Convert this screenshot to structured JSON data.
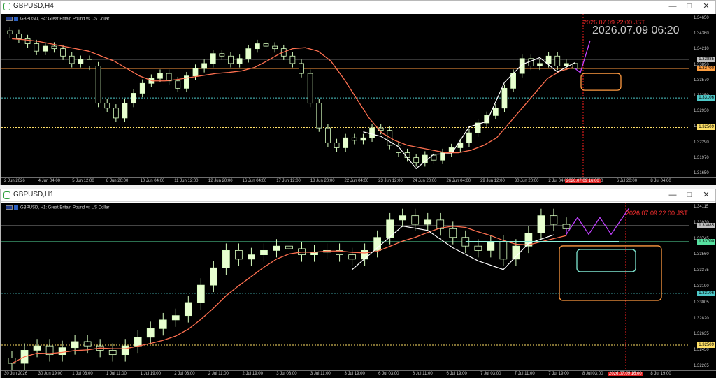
{
  "windows": [
    {
      "title": "GBPUSD,H4",
      "header": "GBPUSD, H4:  Great Britain Pound vs US Dollar",
      "overlay_date": "2026.07.09 06:20",
      "marker_label": "2026.07.09 22:00 JST",
      "cursor_date_tag": "2026.07.09 16:00",
      "price_ticks": [
        "1.34650",
        "1.34360",
        "1.34210",
        "1.33890",
        "1.33570",
        "1.33250",
        "1.32930",
        "1.32610",
        "1.32290",
        "1.31970",
        "1.31650"
      ],
      "price_tags": [
        {
          "value": "1.33885",
          "color": "#c0c0c0"
        },
        {
          "value": "1.33700",
          "color": "#ff9f40"
        },
        {
          "value": "1.33106",
          "color": "#4ec9c9"
        },
        {
          "value": "1.32509",
          "color": "#ffe066"
        }
      ],
      "time_ticks": [
        "2 Jun 2026",
        "4 Jun 04:00",
        "5 Jun 12:00",
        "8 Jun 20:00",
        "10 Jun 04:00",
        "11 Jun 12:00",
        "12 Jun 20:00",
        "16 Jun 04:00",
        "17 Jun 12:00",
        "18 Jun 20:00",
        "22 Jun 04:00",
        "23 Jun 12:00",
        "24 Jun 20:00",
        "26 Jun 04:00",
        "29 Jun 12:00",
        "30 Jun 20:00",
        "2 Jul 04:00",
        "3 Jul 12:00",
        "6 Jul 20:00",
        "8 Jul 04:00"
      ]
    },
    {
      "title": "GBPUSD,H1",
      "header": "GBPUSD, H1:  Great Britain Pound vs US Dollar",
      "marker_label": "2026.07.09 22:00 JST",
      "cursor_date_tag": "2026.07.09 16:00",
      "price_ticks": [
        "1.34115",
        "1.33930",
        "1.33745",
        "1.33560",
        "1.33375",
        "1.33190",
        "1.33005",
        "1.32820",
        "1.32635",
        "1.32450",
        "1.32265"
      ],
      "price_tags": [
        {
          "value": "1.33885",
          "color": "#c0c0c0"
        },
        {
          "value": "1.33700",
          "color": "#57e0a0"
        },
        {
          "value": "1.33106",
          "color": "#4ec9c9"
        },
        {
          "value": "1.32509",
          "color": "#ffe066"
        }
      ],
      "time_ticks": [
        "30 Jun 2026",
        "30 Jun 19:00",
        "1 Jul 03:00",
        "1 Jul 11:00",
        "1 Jul 19:00",
        "2 Jul 03:00",
        "2 Jul 11:00",
        "2 Jul 19:00",
        "3 Jul 03:00",
        "3 Jul 11:00",
        "3 Jul 19:00",
        "6 Jul 03:00",
        "6 Jul 11:00",
        "6 Jul 19:00",
        "7 Jul 03:00",
        "7 Jul 11:00",
        "7 Jul 19:00",
        "8 Jul 03:00",
        "8 Jul 11:00",
        "8 Jul 19:00"
      ]
    }
  ],
  "colors": {
    "bull": "#e8ffd0",
    "bear": "#cfffb0",
    "ma": "#ff7050",
    "zigzag": "#ffffff",
    "projection": "#c040ff",
    "marker": "#ff2020",
    "box": "#ff9a40",
    "box2": "#7fe6d0"
  },
  "chart_data": [
    {
      "type": "candlestick",
      "title": "GBPUSD, H4",
      "ylim": [
        1.315,
        1.348
      ],
      "closes": [
        1.344,
        1.343,
        1.342,
        1.3405,
        1.3415,
        1.341,
        1.3395,
        1.338,
        1.3388,
        1.3375,
        1.33,
        1.329,
        1.327,
        1.33,
        1.332,
        1.334,
        1.335,
        1.336,
        1.3345,
        1.333,
        1.3355,
        1.337,
        1.338,
        1.34,
        1.3395,
        1.338,
        1.339,
        1.341,
        1.342,
        1.3415,
        1.341,
        1.3395,
        1.338,
        1.336,
        1.33,
        1.325,
        1.322,
        1.321,
        1.323,
        1.3225,
        1.323,
        1.325,
        1.3245,
        1.3215,
        1.32,
        1.319,
        1.318,
        1.3195,
        1.3185,
        1.32,
        1.321,
        1.322,
        1.324,
        1.326,
        1.3275,
        1.329,
        1.333,
        1.336,
        1.339,
        1.3375,
        1.338,
        1.3395,
        1.3375,
        1.338,
        1.337
      ],
      "ma": [
        1.343,
        1.3428,
        1.3425,
        1.342,
        1.3415,
        1.341,
        1.3405,
        1.3395,
        1.3385,
        1.337,
        1.3355,
        1.3345,
        1.3345,
        1.3348,
        1.3352,
        1.3356,
        1.336,
        1.3362,
        1.3365,
        1.3372,
        1.3385,
        1.34,
        1.341,
        1.3412,
        1.3405,
        1.3385,
        1.335,
        1.331,
        1.327,
        1.324,
        1.3225,
        1.3215,
        1.321,
        1.3205,
        1.32,
        1.32,
        1.3205,
        1.3215,
        1.323,
        1.326,
        1.329,
        1.332,
        1.335,
        1.3365,
        1.3372
      ],
      "levels": [
        1.33885,
        1.337,
        1.33106,
        1.32509
      ]
    },
    {
      "type": "candlestick",
      "title": "GBPUSD, H1",
      "ylim": [
        1.3222,
        1.3415
      ],
      "closes": [
        1.323,
        1.3245,
        1.325,
        1.324,
        1.3248,
        1.3255,
        1.325,
        1.3245,
        1.324,
        1.325,
        1.326,
        1.327,
        1.328,
        1.3285,
        1.33,
        1.332,
        1.334,
        1.336,
        1.335,
        1.3355,
        1.336,
        1.3365,
        1.3362,
        1.3355,
        1.3358,
        1.336,
        1.3355,
        1.335,
        1.336,
        1.3375,
        1.3395,
        1.34,
        1.339,
        1.3395,
        1.3385,
        1.3375,
        1.3365,
        1.336,
        1.337,
        1.335,
        1.3365,
        1.338,
        1.34,
        1.339,
        1.3385
      ],
      "levels": [
        1.33885,
        1.337,
        1.33106,
        1.32509
      ]
    }
  ]
}
